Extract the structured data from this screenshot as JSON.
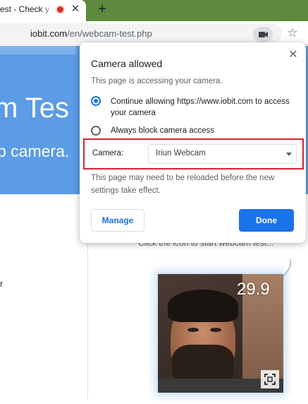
{
  "browser": {
    "tab_title": "est - Check y",
    "tab_close": "✕",
    "new_tab": "+",
    "url_host": "iobit.com",
    "url_path": "/en/webcam-test.php",
    "star": "☆"
  },
  "page": {
    "hero_title": "m Tes",
    "hero_sub": "b camera.",
    "side_text": "r",
    "hint": "Click the icon to start webcam test...",
    "fps": "29.9"
  },
  "popup": {
    "title": "Camera allowed",
    "close": "✕",
    "description": "This page is accessing your camera.",
    "option_allow": "Continue allowing https://www.iobit.com to access your camera",
    "option_block": "Always block camera access",
    "camera_label": "Camera:",
    "camera_selected": "Iriun Webcam",
    "note": "This page may need to be reloaded before the new settings take effect.",
    "manage_label": "Manage",
    "done_label": "Done"
  },
  "colors": {
    "accent": "#1a73e8",
    "highlight_border": "#d6232f",
    "hero_blue": "#5c9be6",
    "tabstrip_green": "#5d8a3c"
  }
}
